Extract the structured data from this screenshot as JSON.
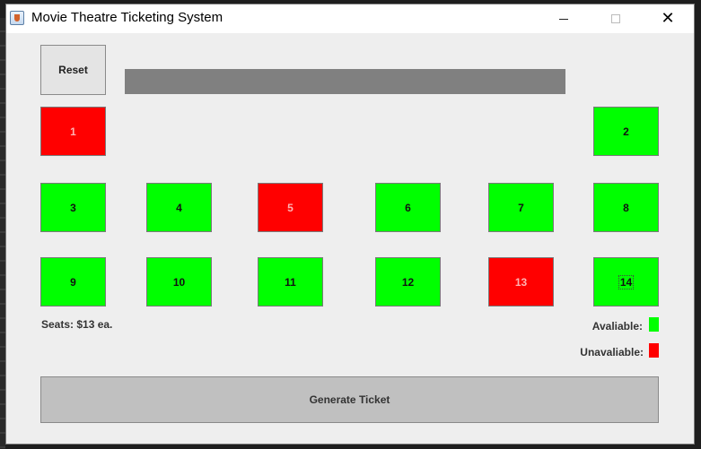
{
  "window": {
    "title": "Movie Theatre Ticketing System",
    "icon": "java-cup-icon",
    "controls": {
      "minimize": "minimize-icon",
      "maximize": "maximize-icon",
      "close": "✕"
    }
  },
  "toolbar": {
    "reset_label": "Reset"
  },
  "seats": [
    {
      "label": "1",
      "status": "unavailable"
    },
    {
      "label": "2",
      "status": "available"
    },
    {
      "label": "3",
      "status": "available"
    },
    {
      "label": "4",
      "status": "available"
    },
    {
      "label": "5",
      "status": "unavailable"
    },
    {
      "label": "6",
      "status": "available"
    },
    {
      "label": "7",
      "status": "available"
    },
    {
      "label": "8",
      "status": "available"
    },
    {
      "label": "9",
      "status": "available"
    },
    {
      "label": "10",
      "status": "available"
    },
    {
      "label": "11",
      "status": "available"
    },
    {
      "label": "12",
      "status": "available"
    },
    {
      "label": "13",
      "status": "unavailable"
    },
    {
      "label": "14",
      "status": "available"
    }
  ],
  "info": {
    "price_text": "Seats: $13 ea."
  },
  "legend": {
    "available_label": "Avaliable:",
    "unavailable_label": "Unavaliable:",
    "available_color": "#00ff00",
    "unavailable_color": "#ff0000"
  },
  "actions": {
    "generate_label": "Generate Ticket"
  },
  "colors": {
    "display_bar": "#808080",
    "window_bg": "#eeeeee"
  }
}
